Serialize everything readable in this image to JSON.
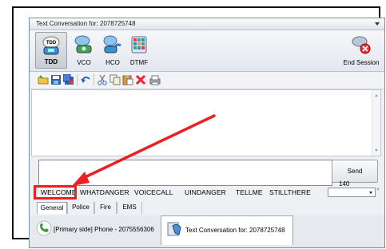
{
  "window": {
    "title": "Text Conversation for: 2078725748"
  },
  "ribbon": {
    "buttons": [
      {
        "label": "TDD",
        "icon": "tdd-phone-icon"
      },
      {
        "label": "VCO",
        "icon": "vco-icon"
      },
      {
        "label": "HCO",
        "icon": "hco-icon"
      },
      {
        "label": "DTMF",
        "icon": "dtmf-keypad-icon"
      }
    ],
    "end_session_label": "End Session"
  },
  "toolbar": {
    "icons": [
      "open-folder-icon",
      "save-icon",
      "save-all-icon",
      "undo-icon",
      "cut-icon",
      "copy-icon",
      "paste-icon",
      "delete-icon",
      "print-icon"
    ]
  },
  "composer": {
    "send_label": "Send",
    "char_count": "140",
    "value": ""
  },
  "quick_phrases": [
    "WELCOME",
    "WHATDANGER",
    "VOICECALL",
    "UINDANGER",
    "TELLME",
    "STILLTHERE"
  ],
  "phrase_more": "»",
  "category_tabs": [
    "General",
    "Police",
    "Fire",
    "EMS"
  ],
  "active_category": "General",
  "document_tabs": [
    {
      "label": "[Primary side] Phone - 2075556306",
      "icon": "phone-handset-icon"
    },
    {
      "label": "Text Conversation for: 2078725748",
      "icon": "text-conversation-icon"
    }
  ],
  "colors": {
    "annotation": "#ef1f1f",
    "accent": "#2b62b8"
  }
}
